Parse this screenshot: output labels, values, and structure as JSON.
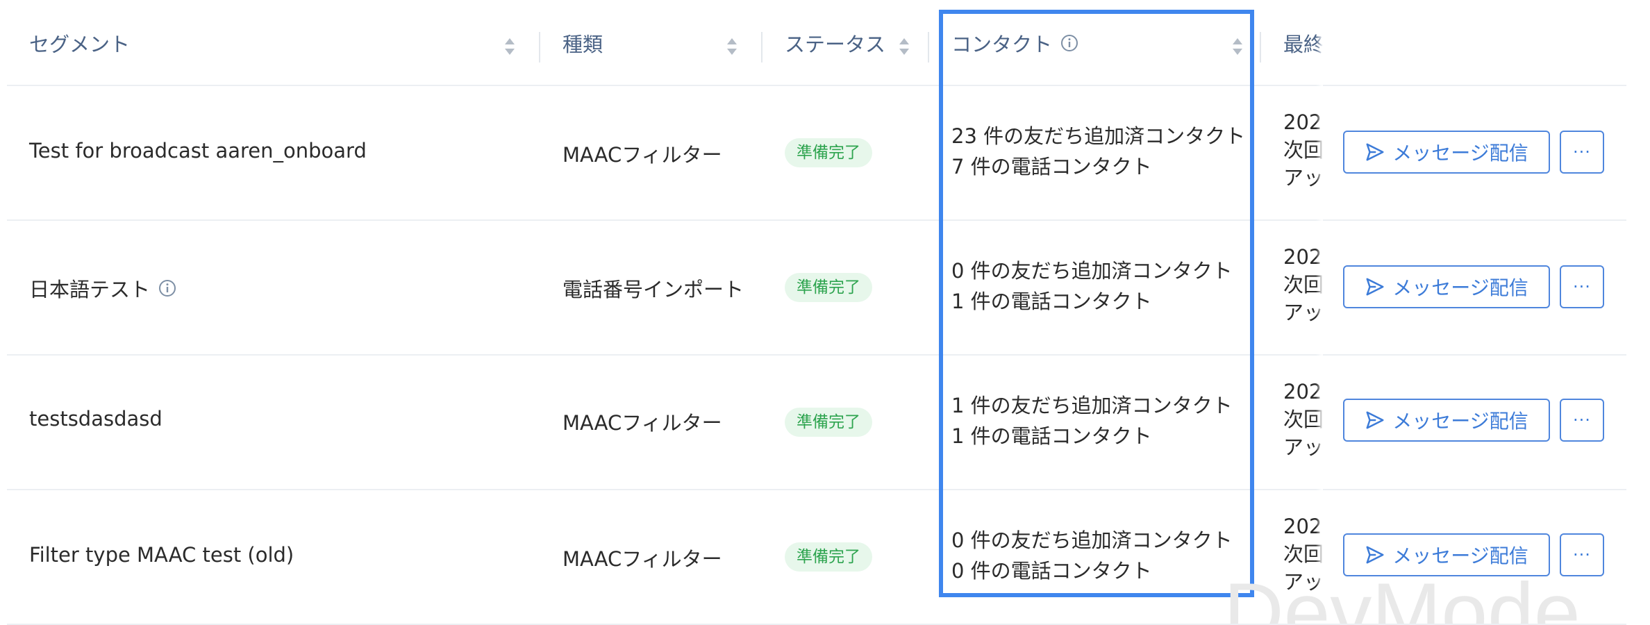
{
  "columns": {
    "segment": "セグメント",
    "type": "種類",
    "status": "ステータス",
    "contact": "コンタクト",
    "last": "最終"
  },
  "rows": [
    {
      "segment": "Test for broadcast aaren_onboard",
      "has_info": false,
      "type": "MAACフィルター",
      "status": "準備完了",
      "friend_contacts": "23 件の友だち追加済コンタクト",
      "phone_contacts": "7 件の電話コンタクト",
      "last_line1": "202",
      "last_line2": "次回",
      "last_line3": "アッ",
      "send_label": "メッセージ配信",
      "more_label": "···"
    },
    {
      "segment": "日本語テスト",
      "has_info": true,
      "type": "電話番号インポート",
      "status": "準備完了",
      "friend_contacts": "0 件の友だち追加済コンタクト",
      "phone_contacts": "1 件の電話コンタクト",
      "last_line1": "202",
      "last_line2": "次回",
      "last_line3": "アッ",
      "send_label": "メッセージ配信",
      "more_label": "···"
    },
    {
      "segment": "testsdasdasd",
      "has_info": false,
      "type": "MAACフィルター",
      "status": "準備完了",
      "friend_contacts": "1 件の友だち追加済コンタクト",
      "phone_contacts": "1 件の電話コンタクト",
      "last_line1": "202",
      "last_line2": "次回",
      "last_line3": "アッ",
      "send_label": "メッセージ配信",
      "more_label": "···"
    },
    {
      "segment": "Filter type MAAC test (old)",
      "has_info": false,
      "type": "MAACフィルター",
      "status": "準備完了",
      "friend_contacts": "0 件の友だち追加済コンタクト",
      "phone_contacts": "0 件の電話コンタクト",
      "last_line1": "202",
      "last_line2": "次回",
      "last_line3": "アッ",
      "send_label": "メッセージ配信",
      "more_label": "···"
    }
  ],
  "watermark": "DevMode",
  "colors": {
    "accent": "#3c7bd8",
    "highlight": "#3f86ee",
    "badge_bg": "#e7f7eb",
    "badge_text": "#2ea44f",
    "header_text": "#4a6285"
  }
}
